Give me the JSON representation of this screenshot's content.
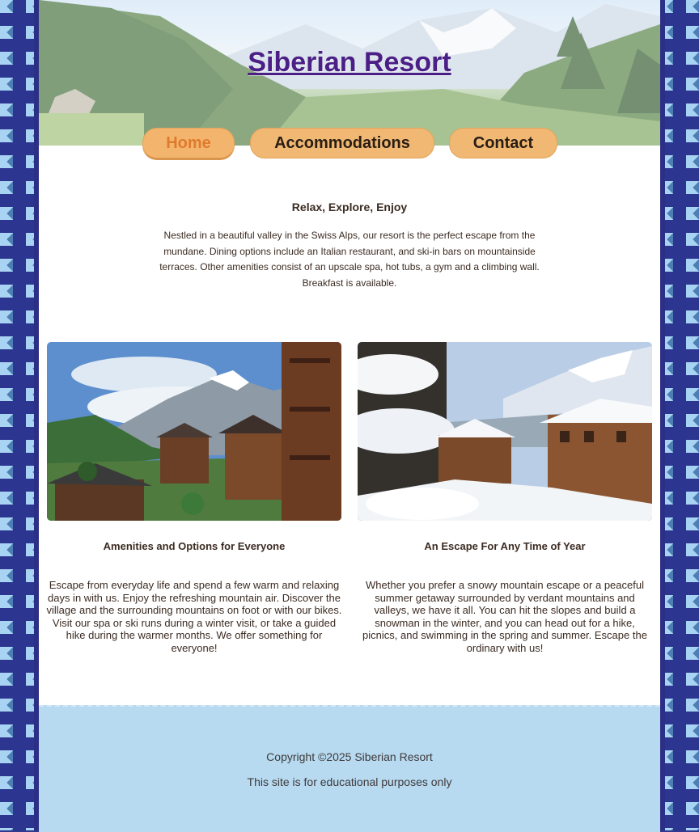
{
  "header": {
    "site_title": "Siberian Resort",
    "nav": [
      {
        "label": "Home",
        "active": true
      },
      {
        "label": "Accommodations",
        "active": false
      },
      {
        "label": "Contact",
        "active": false
      }
    ]
  },
  "intro": {
    "heading": "Relax, Explore, Enjoy",
    "body": "Nestled in a beautiful valley in the Swiss Alps, our resort is the perfect escape from the mundane. Dining options include an Italian restaurant, and ski-in bars on mountainside terraces. Other amenities consist of an upscale spa, hot tubs, a gym and a climbing wall. Breakfast is available."
  },
  "features": [
    {
      "heading": "Amenities and Options for Everyone",
      "body": "Escape from everyday life and spend a few warm and relaxing days in with us. Enjoy the refreshing mountain air. Discover the village and the surrounding mountains on foot or with our bikes. Visit our spa or ski runs during a winter visit, or take a guided hike during the warmer months. We offer something for everyone!"
    },
    {
      "heading": "An Escape For Any Time of Year",
      "body": "Whether you prefer a snowy mountain escape or a peaceful summer getaway surrounded by verdant mountains and valleys, we have it all. You can hit the slopes and build a snowman in the winter, and you can head out for a hike, picnics, and swimming in the spring and summer. Escape the ordinary with us!"
    }
  ],
  "footer": {
    "copyright": "Copyright ©2025 Siberian Resort",
    "note": "This site is for educational purposes only"
  },
  "colors": {
    "title": "#4b1f86",
    "nav_button": "#f0b873",
    "nav_active_text": "#e07b2e",
    "footer_bg": "#b7daf1",
    "side_pattern_dark": "#2c3590",
    "side_pattern_light": "#a9d3f2"
  }
}
